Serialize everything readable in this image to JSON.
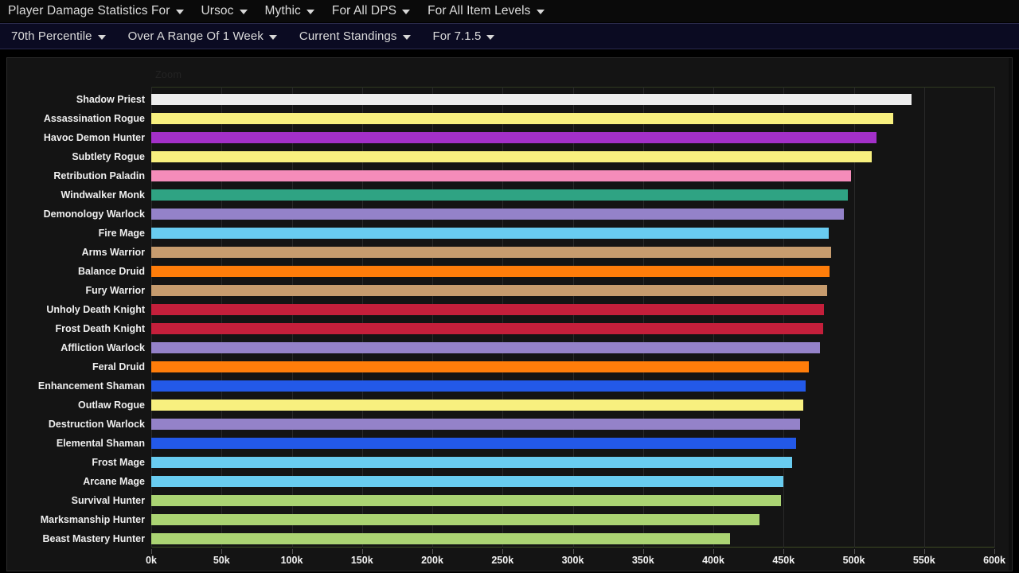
{
  "navbar_primary": {
    "items": [
      {
        "label": "Player Damage Statistics For",
        "has_caret": true
      },
      {
        "label": "Ursoc",
        "has_caret": true
      },
      {
        "label": "Mythic",
        "has_caret": true
      },
      {
        "label": "For All DPS",
        "has_caret": true
      },
      {
        "label": "For All Item Levels",
        "has_caret": true
      }
    ]
  },
  "navbar_secondary": {
    "items": [
      {
        "label": "70th Percentile",
        "has_caret": true
      },
      {
        "label": "Over A Range Of 1 Week",
        "has_caret": true
      },
      {
        "label": "Current Standings",
        "has_caret": true
      },
      {
        "label": "For 7.1.5",
        "has_caret": true
      }
    ]
  },
  "chart_overlay": {
    "zoom_label": "Zoom"
  },
  "colors": {
    "panel_background": "#141414",
    "navbar_primary_background": "#0a0a0a",
    "navbar_secondary_background": "#0b0b22",
    "gridline": "#2a2a2a",
    "text": "#efefef"
  },
  "chart_data": {
    "type": "bar",
    "orientation": "horizontal",
    "title": "Player Damage Statistics For Ursoc - Mythic - For All DPS - For All Item Levels",
    "subtitle": "70th Percentile, Over A Range Of 1 Week, Current Standings, For 7.1.5",
    "xlabel": "",
    "ylabel": "",
    "xlim": [
      0,
      600000
    ],
    "grid": true,
    "legend": "none",
    "tick_labels": [
      "0k",
      "50k",
      "100k",
      "150k",
      "200k",
      "250k",
      "300k",
      "350k",
      "400k",
      "450k",
      "500k",
      "550k",
      "600k"
    ],
    "tick_values": [
      0,
      50000,
      100000,
      150000,
      200000,
      250000,
      300000,
      350000,
      400000,
      450000,
      500000,
      550000,
      600000
    ],
    "categories": [
      "Shadow Priest",
      "Assassination Rogue",
      "Havoc Demon Hunter",
      "Subtlety Rogue",
      "Retribution Paladin",
      "Windwalker Monk",
      "Demonology Warlock",
      "Fire Mage",
      "Arms Warrior",
      "Balance Druid",
      "Fury Warrior",
      "Unholy Death Knight",
      "Frost Death Knight",
      "Affliction Warlock",
      "Feral Druid",
      "Enhancement Shaman",
      "Outlaw Rogue",
      "Destruction Warlock",
      "Elemental Shaman",
      "Frost Mage",
      "Arcane Mage",
      "Survival Hunter",
      "Marksmanship Hunter",
      "Beast Mastery Hunter"
    ],
    "values": [
      541000,
      528000,
      516000,
      513000,
      498000,
      496000,
      493000,
      482000,
      484000,
      483000,
      481000,
      479000,
      478000,
      476000,
      468000,
      466000,
      464000,
      462000,
      459000,
      456000,
      450000,
      448000,
      433000,
      412000
    ],
    "colors": [
      "#eeeeee",
      "#f8f07f",
      "#a330c9",
      "#f8f07f",
      "#f58cba",
      "#2fa383",
      "#9482c9",
      "#69ccf0",
      "#c79c6e",
      "#ff7d0a",
      "#c79c6e",
      "#c41f3b",
      "#c41f3b",
      "#9482c9",
      "#ff7d0a",
      "#2359e8",
      "#f8f07f",
      "#9482c9",
      "#2359e8",
      "#69ccf0",
      "#69ccf0",
      "#abd473",
      "#abd473",
      "#abd473"
    ]
  }
}
